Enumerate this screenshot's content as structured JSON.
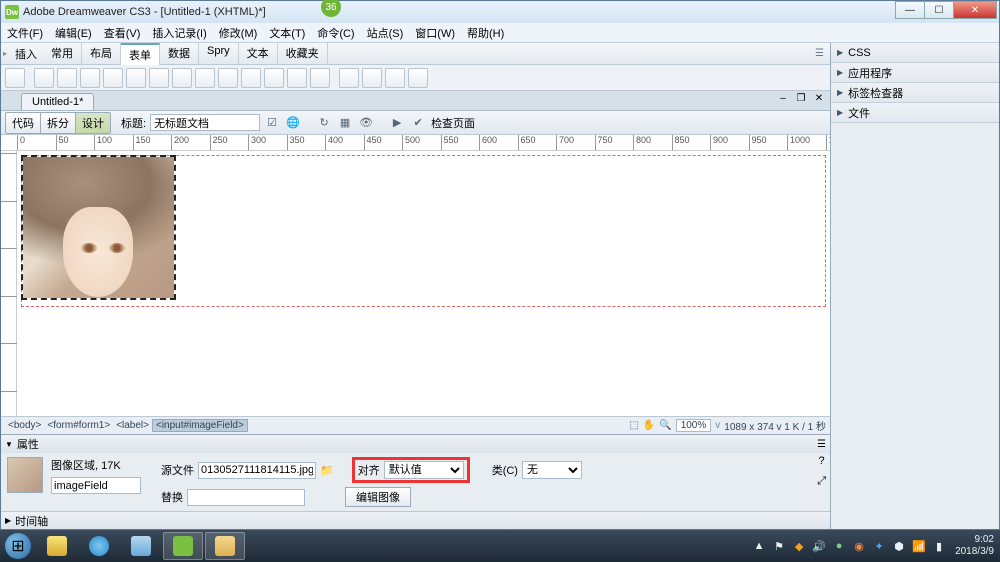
{
  "title": "Adobe Dreamweaver CS3 - [Untitled-1 (XHTML)*]",
  "badge": "36",
  "menus": [
    "文件(F)",
    "编辑(E)",
    "查看(V)",
    "插入记录(I)",
    "修改(M)",
    "文本(T)",
    "命令(C)",
    "站点(S)",
    "窗口(W)",
    "帮助(H)"
  ],
  "insert": {
    "label": "插入",
    "tabs": [
      "常用",
      "布局",
      "表单",
      "数据",
      "Spry",
      "文本",
      "收藏夹"
    ],
    "active": 2
  },
  "doc_tab": "Untitled-1*",
  "view_btns": {
    "code": "代码",
    "split": "拆分",
    "design": "设计"
  },
  "title_label": "标题:",
  "title_value": "无标题文档",
  "check_page": "检查页面",
  "ruler_max": 1050,
  "status": {
    "tags": [
      "<body>",
      "<form#form1>",
      "<label>",
      "<input#imageField>"
    ],
    "zoom": "100%",
    "dims": "1089 x 374 v 1 K / 1 秒"
  },
  "props": {
    "title": "属性",
    "img_label": "图像区域,  17K",
    "name_value": "imageField",
    "src_label": "源文件",
    "src_value": "0130527111814115.jpg",
    "alt_label": "替换",
    "alt_value": "",
    "align_label": "对齐",
    "align_value": "默认值",
    "class_label": "类(C)",
    "class_value": "无",
    "edit_btn": "编辑图像"
  },
  "timeline": "时间轴",
  "right_panels": [
    "CSS",
    "应用程序",
    "标签检查器",
    "文件"
  ],
  "clock": {
    "time": "9:02",
    "date": "2018/3/9"
  }
}
